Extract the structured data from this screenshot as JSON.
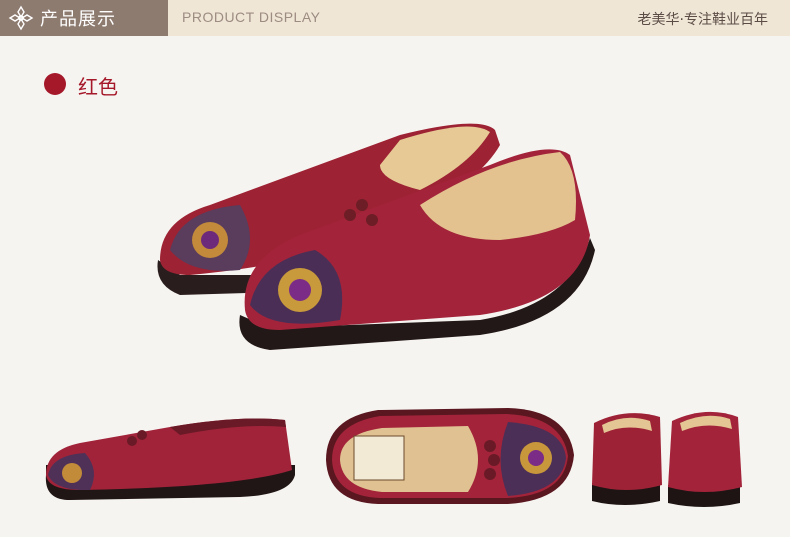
{
  "header": {
    "title_cn": "产品展示",
    "title_en": "PRODUCT DISPLAY",
    "brand": "老美华·专注鞋业百年"
  },
  "color": {
    "label": "红色",
    "swatch": "#a5182a"
  },
  "images": [
    {
      "name": "main-pair"
    },
    {
      "name": "side-view"
    },
    {
      "name": "top-view"
    },
    {
      "name": "back-view"
    }
  ]
}
